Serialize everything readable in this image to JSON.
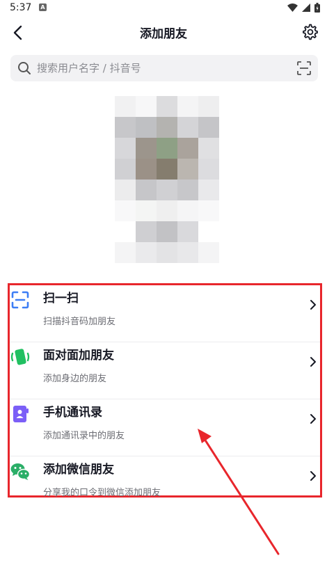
{
  "status_bar": {
    "time": "5:37",
    "notification": "A"
  },
  "header": {
    "title": "添加朋友"
  },
  "search": {
    "placeholder": "搜索用户名字 / 抖音号"
  },
  "options": [
    {
      "label": "扫一扫",
      "subtitle": "扫描抖音码加朋友",
      "icon": "scan-icon"
    },
    {
      "label": "面对面加朋友",
      "subtitle": "添加身边的朋友",
      "icon": "phone-shake-icon"
    },
    {
      "label": "手机通讯录",
      "subtitle": "添加通讯录中的朋友",
      "icon": "contacts-book-icon"
    },
    {
      "label": "添加微信朋友",
      "subtitle": "分享我的口令到微信添加朋友",
      "icon": "wechat-icon"
    }
  ],
  "colors": {
    "accent_blue": "#3d7ef5",
    "green": "#21c061",
    "purple": "#7b5ff7",
    "wechat_green": "#2aae67",
    "highlight_red": "#e8262c"
  }
}
